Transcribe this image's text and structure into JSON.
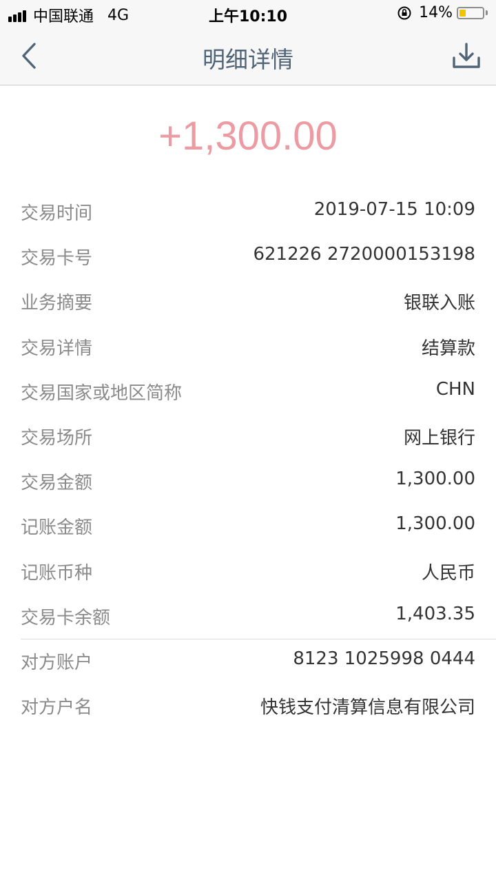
{
  "status_bar": {
    "carrier": "中国联通",
    "network": "4G",
    "time": "上午10:10",
    "battery": "14%",
    "battery_level": 0.14
  },
  "nav": {
    "title": "明细详情",
    "back_icon": "chevron-left-icon",
    "download_icon": "download-icon"
  },
  "amount": "+1,300.00",
  "colors": {
    "amount": "#ec9ba3",
    "nav_title": "#506478",
    "label": "#8a8a8a",
    "value": "#333333"
  },
  "details": [
    {
      "label": "交易时间",
      "value": "2019-07-15 10:09"
    },
    {
      "label": "交易卡号",
      "value": "621226 2720000153198"
    },
    {
      "label": "业务摘要",
      "value": "银联入账"
    },
    {
      "label": "交易详情",
      "value": "结算款"
    },
    {
      "label": "交易国家或地区简称",
      "value": "CHN"
    },
    {
      "label": "交易场所",
      "value": "网上银行"
    },
    {
      "label": "交易金额",
      "value": "1,300.00"
    },
    {
      "label": "记账金额",
      "value": "1,300.00"
    },
    {
      "label": "记账币种",
      "value": "人民币"
    },
    {
      "label": "交易卡余额",
      "value": "1,403.35"
    },
    {
      "label": "对方账户",
      "value": "8123 1025998 0444"
    },
    {
      "label": "对方户名",
      "value": "快钱支付清算信息有限公司"
    }
  ]
}
